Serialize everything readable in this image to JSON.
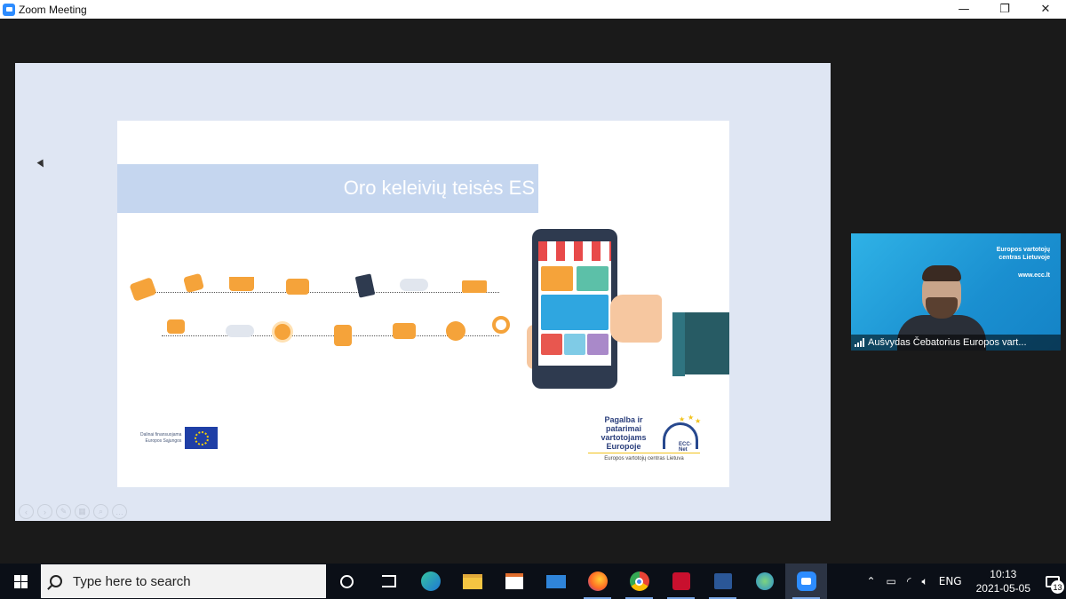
{
  "window": {
    "title": "Zoom Meeting",
    "controls": {
      "minimize": "—",
      "restore": "❐",
      "close": "✕"
    }
  },
  "slide": {
    "title": "Oro keleivių teisės ES",
    "eu_funding_line1": "Dalinai finansuojama",
    "eu_funding_line2": "Europos Sąjungos",
    "ecc_line1": "Pagalba ir patarimai",
    "ecc_line2": "vartotojams",
    "ecc_line3": "Europoje",
    "ecc_logo_text": "ECC-Net",
    "ecc_subtitle": "Europos vartotojų centras Lietuva",
    "shop_icons": [
      "money-icon",
      "tag-icon",
      "basket-icon",
      "card-icon",
      "clipboard-icon",
      "cloud-icon",
      "truck-icon",
      "chat-icon",
      "cloud-icon",
      "clock-icon",
      "bag-icon",
      "money-icon",
      "coin-icon",
      "magnifier-icon"
    ]
  },
  "video": {
    "participant_name": "Aušvydas Čebatorius Europos vart...",
    "bg_text_line1": "Europos vartotojų",
    "bg_text_line2": "centras Lietuvoje",
    "bg_url": "www.ecc.lt"
  },
  "taskbar": {
    "search_placeholder": "Type here to search",
    "apps": [
      "cortana-icon",
      "task-view-icon",
      "edge-icon",
      "file-explorer-icon",
      "store-icon",
      "mail-icon",
      "firefox-icon",
      "chrome-icon",
      "acrobat-icon",
      "word-icon",
      "globe-app-icon",
      "zoom-icon"
    ],
    "language": "ENG",
    "time": "10:13",
    "date": "2021-05-05",
    "notification_count": "13"
  },
  "colors": {
    "banner": "#c5d6ef",
    "share_bg": "#dfe6f3",
    "accent_orange": "#f5a33a",
    "zoom_blue": "#2d8cff"
  }
}
